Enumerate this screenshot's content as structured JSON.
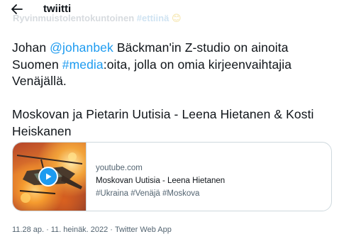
{
  "header": {
    "title": "twiitti",
    "ghost_text_start": "Ryvinmuistolentokuntoinen ",
    "ghost_hashtag": "#ettiinä",
    "ghost_emoji": "😊"
  },
  "tweet": {
    "line1_pre": "Johan ",
    "mention": "@johanbek",
    "line1_post": " Bäckman'in Z-studio on ainoita Suomen ",
    "hashtag_media": "#media",
    "line1_end": ":oita, jolla on omia kirjeenvaihtajia Venäjällä.",
    "line2": "Moskovan ja Pietarin Uutisia - Leena Hietanen & Kosti Heiskanen"
  },
  "card": {
    "domain": "youtube.com",
    "title": "Moskovan Uutisia - Leena Hietanen",
    "description": "#Ukraina #Venäjä #Moskova",
    "thumbnail_icon": "play-icon",
    "play_color": "#1d9bf0"
  },
  "meta": {
    "time": "11.28 ap.",
    "date": "11. heinäk. 2022",
    "source": "Twitter Web App",
    "separator": "·"
  },
  "colors": {
    "accent": "#1d9bf0",
    "text": "#0f1419",
    "secondary": "#536471",
    "border": "#cfd9de"
  }
}
